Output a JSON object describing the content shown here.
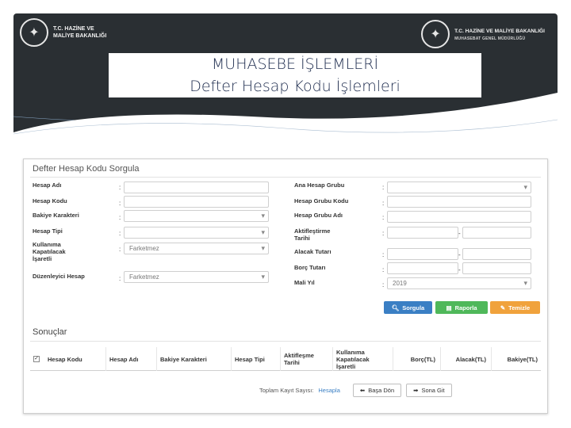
{
  "header": {
    "logo_left_text": "T.C. HAZİNE VE\nMALİYE BAKANLIĞI",
    "logo_right_text": "T.C. HAZİNE VE MALİYE BAKANLIĞI",
    "logo_right_sub": "MUHASEBAT GENEL MÜDÜRLÜĞÜ",
    "title_main": "MUHASEBE İŞLEMLERİ",
    "title_sub": "Defter Hesap Kodu İşlemleri"
  },
  "panel": {
    "title": "Defter Hesap Kodu Sorgula",
    "left_fields": [
      {
        "label": "Hesap Adı",
        "value": "",
        "type": "text"
      },
      {
        "label": "Hesap Kodu",
        "value": "",
        "type": "text"
      },
      {
        "label": "Bakiye Karakteri",
        "value": "",
        "type": "select"
      },
      {
        "label": "Hesap Tipi",
        "value": "",
        "type": "select"
      },
      {
        "label": "Kullanıma\nKapatılacak\nİşaretli",
        "value": "Farketmez",
        "type": "select"
      },
      {
        "label": "Düzenleyici Hesap",
        "value": "Farketmez",
        "type": "select"
      }
    ],
    "right_fields": [
      {
        "label": "Ana Hesap Grubu",
        "value": ""
      },
      {
        "label": "Hesap Grubu Kodu",
        "value": ""
      },
      {
        "label": "Hesap Grubu Adı",
        "value": ""
      },
      {
        "label": "Aktifleştirme\nTarihi",
        "value": ""
      },
      {
        "label": "Alacak Tutarı",
        "value": ""
      },
      {
        "label": "Borç Tutarı",
        "value": ""
      },
      {
        "label": "Mali Yıl",
        "value": "2019"
      }
    ],
    "colon": ":",
    "dash": "-",
    "buttons": {
      "query": "Sorgula",
      "report": "Raporla",
      "clear": "Temizle"
    }
  },
  "results": {
    "title": "Sonuçlar",
    "columns": [
      "Hesap Kodu",
      "Hesap Adı",
      "Bakiye Karakteri",
      "Hesap Tipi",
      "Aktifleşme\nTarihi",
      "Kullanıma\nKapatılacak\nİşaretli",
      "Borç(TL)",
      "Alacak(TL)",
      "Bakiye(TL)"
    ],
    "checkbox_mark": "✓",
    "total_label": "Toplam Kayıt Sayısı:",
    "total_link": "Hesapla",
    "first_button": "Başa Dön",
    "last_button": "Sona Git"
  },
  "colors": {
    "banner": "#2a2f33",
    "title": "#1f2d4f",
    "btn_blue": "#3a7fc4",
    "btn_green": "#4fb85a",
    "btn_orange": "#f0a23c"
  },
  "icons": [
    "seal-emblem-icon",
    "search-icon",
    "document-icon",
    "eraser-icon",
    "arrow-left-icon",
    "arrow-right-icon",
    "chevron-down-icon",
    "checkbox-icon"
  ]
}
